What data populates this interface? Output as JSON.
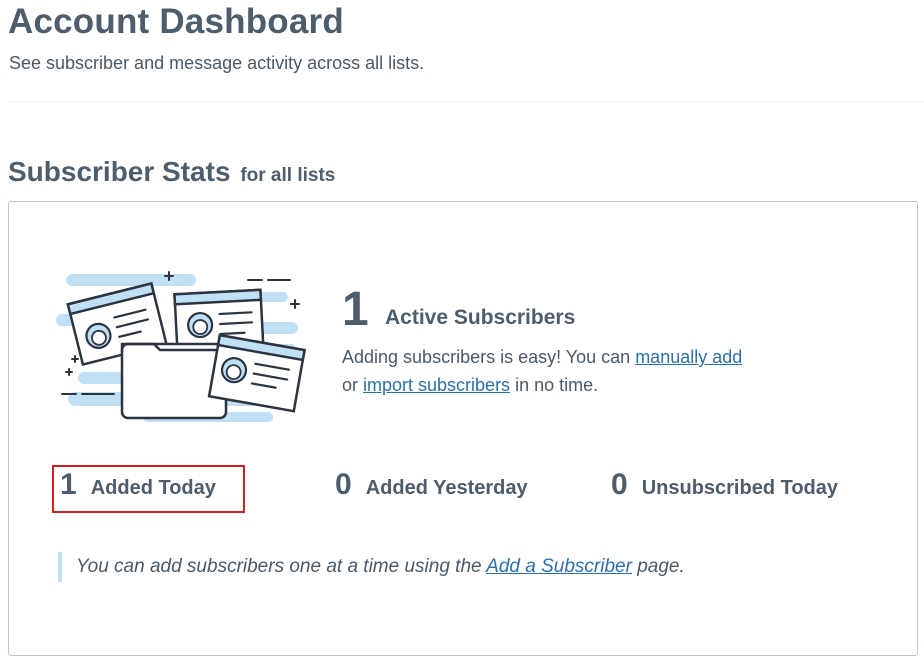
{
  "header": {
    "title": "Account Dashboard",
    "subtitle": "See subscriber and message activity across all lists."
  },
  "section": {
    "title": "Subscriber Stats",
    "suffix": "for all lists"
  },
  "active": {
    "count": "1",
    "label": "Active Subscribers",
    "desc_prefix": "Adding subscribers is easy! You can ",
    "manual_link": "manually add",
    "desc_mid": "or ",
    "import_link": "import subscribers",
    "desc_suffix": " in no time."
  },
  "stats": [
    {
      "value": "1",
      "label": "Added Today"
    },
    {
      "value": "0",
      "label": "Added Yesterday"
    },
    {
      "value": "0",
      "label": "Unsubscribed Today"
    }
  ],
  "tip": {
    "prefix": "You can add subscribers one at a time using the ",
    "link": "Add a Subscriber",
    "suffix": " page."
  },
  "colors": {
    "accent_link": "#2c6fab",
    "illustration_blue": "#bfe0f5",
    "highlight": "#cc1f1f"
  },
  "icons": {
    "illustration": "subscriber-cards-folder-illustration"
  }
}
